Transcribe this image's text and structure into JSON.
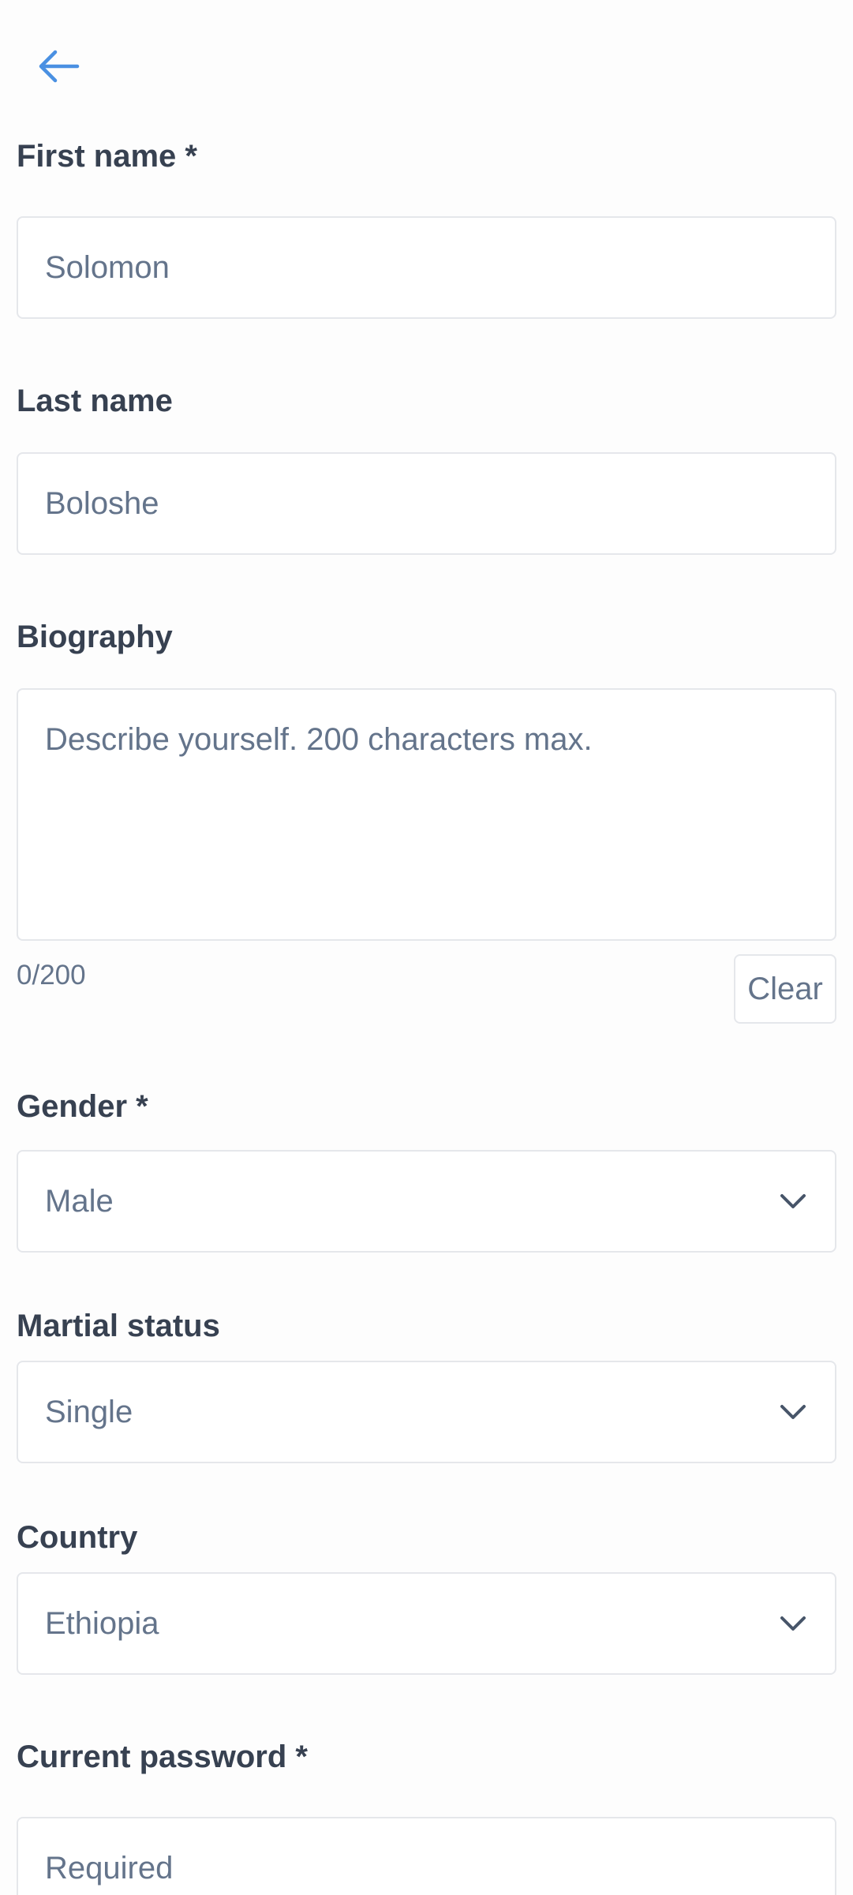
{
  "nav": {
    "back_icon": "arrow-left-icon",
    "accent_color": "#3b82f6"
  },
  "form": {
    "first_name": {
      "label": "First name *",
      "value": "Solomon"
    },
    "last_name": {
      "label": "Last name",
      "value": "Boloshe"
    },
    "biography": {
      "label": "Biography",
      "placeholder": "Describe yourself. 200 characters max.",
      "counter": "0/200",
      "clear_label": "Clear"
    },
    "gender": {
      "label": "Gender *",
      "selected": "Male"
    },
    "marital_status": {
      "label": "Martial status",
      "selected": "Single"
    },
    "country": {
      "label": "Country",
      "selected": "Ethiopia"
    },
    "current_password": {
      "label": "Current password *",
      "placeholder": "Required"
    }
  },
  "colors": {
    "label_text": "#374151",
    "value_text": "#64748b",
    "border": "#e5e7eb"
  }
}
